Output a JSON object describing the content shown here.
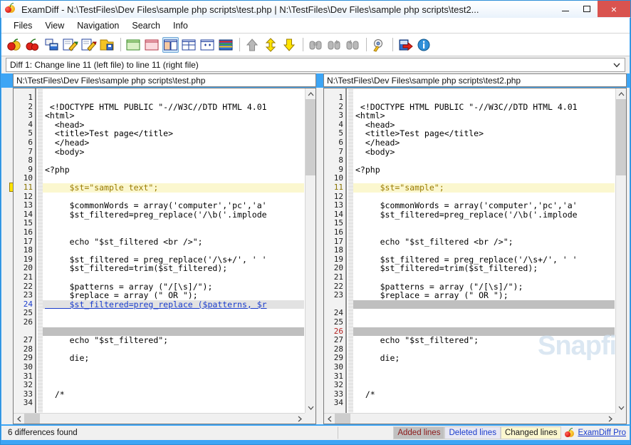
{
  "window": {
    "title": "ExamDiff - N:\\TestFiles\\Dev Files\\sample php scripts\\test.php  |  N:\\TestFiles\\Dev Files\\sample php scripts\\test2...",
    "icon": "examdiff-fruit-icon",
    "minimize_label": "–",
    "maximize_label": "□",
    "close_label": "×"
  },
  "menu": {
    "items": [
      {
        "label": "Files",
        "name": "menu-files"
      },
      {
        "label": "View",
        "name": "menu-view"
      },
      {
        "label": "Navigation",
        "name": "menu-navigation"
      },
      {
        "label": "Search",
        "name": "menu-search"
      },
      {
        "label": "Info",
        "name": "menu-info"
      }
    ]
  },
  "toolbar": {
    "buttons": [
      {
        "name": "compare-files-icon",
        "tip": "Compare Files"
      },
      {
        "name": "compare-directories-icon",
        "tip": "Compare Directories"
      },
      {
        "name": "recompare-icon",
        "tip": "Recompare"
      },
      {
        "name": "edit-left-file-icon",
        "tip": "Edit Left File"
      },
      {
        "name": "edit-right-file-icon",
        "tip": "Edit Right File"
      },
      {
        "name": "save-icon",
        "tip": "Save"
      },
      {
        "name": "view-left-only-icon",
        "tip": "View Left File Only"
      },
      {
        "name": "view-right-only-icon",
        "tip": "View Right File Only"
      },
      {
        "name": "view-side-by-side-icon",
        "tip": "Side by Side View"
      },
      {
        "name": "view-horizontal-split-icon",
        "tip": "Horizontal Split View"
      },
      {
        "name": "view-sync-scroll-icon",
        "tip": "Synchronize Scrolling"
      },
      {
        "name": "view-inline-icon",
        "tip": "Inline View"
      },
      {
        "name": "first-diff-icon",
        "tip": "First Difference"
      },
      {
        "name": "next-diff-icon",
        "tip": "Next Difference"
      },
      {
        "name": "last-diff-icon",
        "tip": "Last Difference"
      },
      {
        "name": "find-icon",
        "tip": "Find"
      },
      {
        "name": "find-next-icon",
        "tip": "Find Next"
      },
      {
        "name": "find-previous-icon",
        "tip": "Find Previous"
      },
      {
        "name": "options-icon",
        "tip": "Options"
      },
      {
        "name": "exit-icon",
        "tip": "Exit"
      },
      {
        "name": "about-icon",
        "tip": "About"
      }
    ],
    "selected_index": 8
  },
  "diff_selector": {
    "value": "Diff 1: Change line 11 (left file) to line 11 (right file)",
    "arrow": "⌄"
  },
  "files": {
    "left_path": "N:\\TestFiles\\Dev Files\\sample php scripts\\test.php",
    "right_path": "N:\\TestFiles\\Dev Files\\sample php scripts\\test2.php"
  },
  "watermark": "Snapfiles",
  "left_pane": {
    "rows": [
      {
        "n": "1",
        "text": "",
        "state": ""
      },
      {
        "n": "2",
        "text": " <!DOCTYPE HTML PUBLIC \"-//W3C//DTD HTML 4.01",
        "state": ""
      },
      {
        "n": "3",
        "text": "<html>",
        "state": ""
      },
      {
        "n": "4",
        "text": "  <head>",
        "state": ""
      },
      {
        "n": "5",
        "text": "  <title>Test page</title>",
        "state": ""
      },
      {
        "n": "6",
        "text": "  </head>",
        "state": ""
      },
      {
        "n": "7",
        "text": "  <body>",
        "state": ""
      },
      {
        "n": "8",
        "text": "",
        "state": ""
      },
      {
        "n": "9",
        "text": "<?php",
        "state": ""
      },
      {
        "n": "10",
        "text": "",
        "state": ""
      },
      {
        "n": "11",
        "text": "     $st=\"sample text\";",
        "state": "change"
      },
      {
        "n": "12",
        "text": "",
        "state": ""
      },
      {
        "n": "13",
        "text": "     $commonWords = array('computer','pc','a'",
        "state": ""
      },
      {
        "n": "14",
        "text": "     $st_filtered=preg_replace('/\\b('.implode",
        "state": ""
      },
      {
        "n": "15",
        "text": "",
        "state": ""
      },
      {
        "n": "16",
        "text": "",
        "state": ""
      },
      {
        "n": "17",
        "text": "     echo \"$st_filtered <br />\";",
        "state": ""
      },
      {
        "n": "18",
        "text": "",
        "state": ""
      },
      {
        "n": "19",
        "text": "     $st_filtered = preg_replace('/\\s+/', ' '",
        "state": ""
      },
      {
        "n": "20",
        "text": "     $st_filtered=trim($st_filtered);",
        "state": ""
      },
      {
        "n": "21",
        "text": "",
        "state": ""
      },
      {
        "n": "22",
        "text": "     $patterns = array (\"/[\\s]/\");",
        "state": ""
      },
      {
        "n": "23",
        "text": "     $replace = array (\" OR \");",
        "state": ""
      },
      {
        "n": "24",
        "text": "     $st_filtered=preg_replace ($patterns, $r",
        "state": "delete"
      },
      {
        "n": "25",
        "text": "",
        "state": ""
      },
      {
        "n": "26",
        "text": "",
        "state": ""
      },
      {
        "n": "",
        "text": "",
        "state": "filler"
      },
      {
        "n": "27",
        "text": "     echo \"$st_filtered\";",
        "state": ""
      },
      {
        "n": "28",
        "text": "",
        "state": ""
      },
      {
        "n": "29",
        "text": "     die;",
        "state": ""
      },
      {
        "n": "30",
        "text": "",
        "state": ""
      },
      {
        "n": "31",
        "text": "",
        "state": ""
      },
      {
        "n": "32",
        "text": "",
        "state": ""
      },
      {
        "n": "33",
        "text": "  /*",
        "state": ""
      },
      {
        "n": "34",
        "text": "",
        "state": ""
      }
    ]
  },
  "right_pane": {
    "rows": [
      {
        "n": "1",
        "text": "",
        "state": ""
      },
      {
        "n": "2",
        "text": " <!DOCTYPE HTML PUBLIC \"-//W3C//DTD HTML 4.01",
        "state": ""
      },
      {
        "n": "3",
        "text": "<html>",
        "state": ""
      },
      {
        "n": "4",
        "text": "  <head>",
        "state": ""
      },
      {
        "n": "5",
        "text": "  <title>Test page</title>",
        "state": ""
      },
      {
        "n": "6",
        "text": "  </head>",
        "state": ""
      },
      {
        "n": "7",
        "text": "  <body>",
        "state": ""
      },
      {
        "n": "8",
        "text": "",
        "state": ""
      },
      {
        "n": "9",
        "text": "<?php",
        "state": ""
      },
      {
        "n": "10",
        "text": "",
        "state": ""
      },
      {
        "n": "11",
        "text": "     $st=\"sample\";",
        "state": "change"
      },
      {
        "n": "12",
        "text": "",
        "state": ""
      },
      {
        "n": "13",
        "text": "     $commonWords = array('computer','pc','a'",
        "state": ""
      },
      {
        "n": "14",
        "text": "     $st_filtered=preg_replace('/\\b('.implode",
        "state": ""
      },
      {
        "n": "15",
        "text": "",
        "state": ""
      },
      {
        "n": "16",
        "text": "",
        "state": ""
      },
      {
        "n": "17",
        "text": "     echo \"$st_filtered <br />\";",
        "state": ""
      },
      {
        "n": "18",
        "text": "",
        "state": ""
      },
      {
        "n": "19",
        "text": "     $st_filtered = preg_replace('/\\s+/', ' '",
        "state": ""
      },
      {
        "n": "20",
        "text": "     $st_filtered=trim($st_filtered);",
        "state": ""
      },
      {
        "n": "21",
        "text": "",
        "state": ""
      },
      {
        "n": "22",
        "text": "     $patterns = array (\"/[\\s]/\");",
        "state": ""
      },
      {
        "n": "23",
        "text": "     $replace = array (\" OR \");",
        "state": ""
      },
      {
        "n": "",
        "text": "",
        "state": "filler"
      },
      {
        "n": "24",
        "text": "",
        "state": ""
      },
      {
        "n": "25",
        "text": "",
        "state": ""
      },
      {
        "n": "26",
        "text": "",
        "state": "add-filler"
      },
      {
        "n": "27",
        "text": "     echo \"$st_filtered\";",
        "state": ""
      },
      {
        "n": "28",
        "text": "",
        "state": ""
      },
      {
        "n": "29",
        "text": "     die;",
        "state": ""
      },
      {
        "n": "30",
        "text": "",
        "state": ""
      },
      {
        "n": "31",
        "text": "",
        "state": ""
      },
      {
        "n": "32",
        "text": "",
        "state": ""
      },
      {
        "n": "33",
        "text": "  /*",
        "state": ""
      },
      {
        "n": "34",
        "text": "",
        "state": ""
      }
    ]
  },
  "status": {
    "message": "6 differences found",
    "legend_added": "Added lines",
    "legend_deleted": "Deleted lines",
    "legend_changed": "Changed lines",
    "brand": "ExamDiff Pro"
  },
  "colors": {
    "changed_bg": "#fbf7cf",
    "deleted_bg": "#e2e2e2",
    "filler_bg": "#bfbfbf",
    "deleted_fg": "#1a3ccc",
    "added_fg": "#b32020",
    "accent": "#3da5f5",
    "close_red": "#d9534f"
  }
}
